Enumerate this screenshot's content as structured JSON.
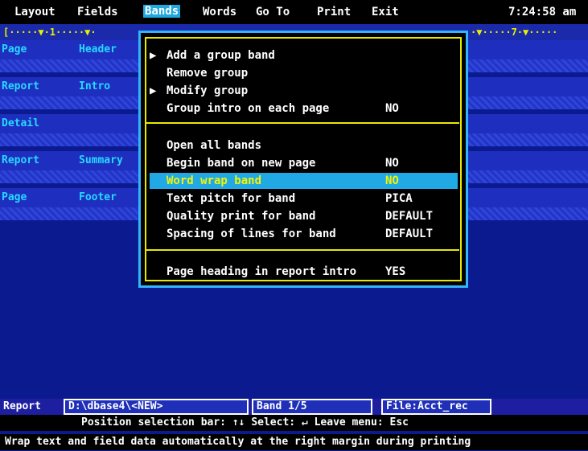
{
  "menubar": {
    "items": [
      "Layout",
      "Fields",
      "Bands",
      "Words",
      "Go To",
      "Print",
      "Exit"
    ],
    "active": "Bands",
    "clock": "7:24:58 am"
  },
  "ruler": {
    "left": "[·····▼·1·····▼·",
    "right": "·▼·····7·▼·····"
  },
  "bands": [
    {
      "name": "Page",
      "title": "Header"
    },
    {
      "name": "Report",
      "title": "Intro"
    },
    {
      "name": "Detail",
      "title": ""
    },
    {
      "name": "Report",
      "title": "Summary"
    },
    {
      "name": "Page",
      "title": "Footer"
    }
  ],
  "dropdown": {
    "rows": [
      {
        "arrow": "▶",
        "label": "Add a group band",
        "value": ""
      },
      {
        "arrow": "",
        "label": "Remove group",
        "value": ""
      },
      {
        "arrow": "▶",
        "label": "Modify group",
        "value": ""
      },
      {
        "arrow": "",
        "label": "Group intro on each page",
        "value": "NO"
      },
      {
        "arrow": "",
        "label": "Open all bands",
        "value": ""
      },
      {
        "arrow": "",
        "label": "Begin band on new page",
        "value": "NO"
      },
      {
        "arrow": "",
        "label": "Word wrap band",
        "value": "NO"
      },
      {
        "arrow": "",
        "label": "Text pitch for band",
        "value": "PICA"
      },
      {
        "arrow": "",
        "label": "Quality print for band",
        "value": "DEFAULT"
      },
      {
        "arrow": "",
        "label": "Spacing of lines for band",
        "value": "DEFAULT"
      },
      {
        "arrow": "",
        "label": "Page heading in report intro",
        "value": "YES"
      }
    ]
  },
  "status": {
    "mode": "Report",
    "path": "D:\\dbase4\\<NEW>",
    "band": "Band 1/5",
    "file": "File:Acct_rec",
    "nav": "Position selection bar: ↑↓    Select: ↵    Leave menu: Esc",
    "help": "Wrap text and field data automatically at the right margin during printing"
  }
}
